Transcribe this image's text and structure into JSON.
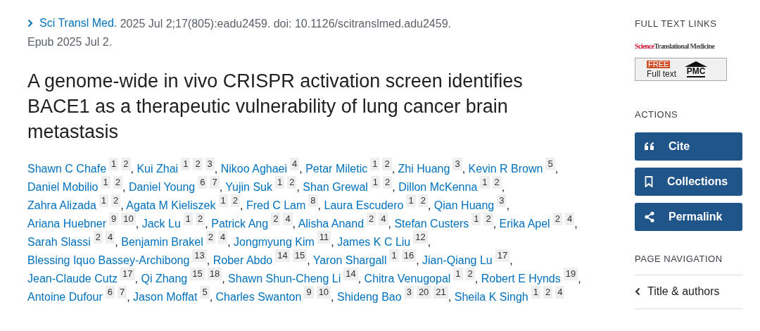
{
  "citation": {
    "journal": "Sci Transl Med.",
    "details": "2025 Jul 2;17(805):eadu2459. doi: 10.1126/scitranslmed.adu2459.",
    "epub": "Epub 2025 Jul 2."
  },
  "title": "A genome-wide in vivo CRISPR activation screen identifies BACE1 as a therapeutic vulnerability of lung cancer brain metastasis",
  "authors": [
    {
      "name": "Shawn C Chafe",
      "affiliations": [
        "1",
        "2"
      ],
      "trailing": ","
    },
    {
      "name": "Kui Zhai",
      "affiliations": [
        "1",
        "2",
        "3"
      ],
      "trailing": ","
    },
    {
      "name": "Nikoo Aghaei",
      "affiliations": [
        "4"
      ],
      "trailing": ","
    },
    {
      "name": "Petar Miletic",
      "affiliations": [
        "1",
        "2"
      ],
      "trailing": ","
    },
    {
      "name": "Zhi Huang",
      "affiliations": [
        "3"
      ],
      "trailing": ","
    },
    {
      "name": "Kevin R Brown",
      "affiliations": [
        "5"
      ],
      "trailing": ","
    },
    {
      "name": "Daniel Mobilio",
      "affiliations": [
        "1",
        "2"
      ],
      "trailing": ","
    },
    {
      "name": "Daniel Young",
      "affiliations": [
        "6",
        "7"
      ],
      "trailing": ","
    },
    {
      "name": "Yujin Suk",
      "affiliations": [
        "1",
        "2"
      ],
      "trailing": ","
    },
    {
      "name": "Shan Grewal",
      "affiliations": [
        "1",
        "2"
      ],
      "trailing": ","
    },
    {
      "name": "Dillon McKenna",
      "affiliations": [
        "1",
        "2"
      ],
      "trailing": ","
    },
    {
      "name": "Zahra Alizada",
      "affiliations": [
        "1",
        "2"
      ],
      "trailing": ","
    },
    {
      "name": "Agata M Kieliszek",
      "affiliations": [
        "1",
        "2"
      ],
      "trailing": ","
    },
    {
      "name": "Fred C Lam",
      "affiliations": [
        "8"
      ],
      "trailing": ","
    },
    {
      "name": "Laura Escudero",
      "affiliations": [
        "1",
        "2"
      ],
      "trailing": ","
    },
    {
      "name": "Qian Huang",
      "affiliations": [
        "3"
      ],
      "trailing": ","
    },
    {
      "name": "Ariana Huebner",
      "affiliations": [
        "9",
        "10"
      ],
      "trailing": ","
    },
    {
      "name": "Jack Lu",
      "affiliations": [
        "1",
        "2"
      ],
      "trailing": ","
    },
    {
      "name": "Patrick Ang",
      "affiliations": [
        "2",
        "4"
      ],
      "trailing": ","
    },
    {
      "name": "Alisha Anand",
      "affiliations": [
        "2",
        "4"
      ],
      "trailing": ","
    },
    {
      "name": "Stefan Custers",
      "affiliations": [
        "1",
        "2"
      ],
      "trailing": ","
    },
    {
      "name": "Erika Apel",
      "affiliations": [
        "2",
        "4"
      ],
      "trailing": ","
    },
    {
      "name": "Sarah Slassi",
      "affiliations": [
        "2",
        "4"
      ],
      "trailing": ","
    },
    {
      "name": "Benjamin Brakel",
      "affiliations": [
        "2",
        "4"
      ],
      "trailing": ","
    },
    {
      "name": "Jongmyung Kim",
      "affiliations": [
        "11"
      ],
      "trailing": ","
    },
    {
      "name": "James K C Liu",
      "affiliations": [
        "12"
      ],
      "trailing": ","
    },
    {
      "name": "Blessing Iquo Bassey-Archibong",
      "affiliations": [
        "13"
      ],
      "trailing": ","
    },
    {
      "name": "Rober Abdo",
      "affiliations": [
        "14",
        "15"
      ],
      "trailing": ","
    },
    {
      "name": "Yaron Shargall",
      "affiliations": [
        "1",
        "16"
      ],
      "trailing": ","
    },
    {
      "name": "Jian-Qiang Lu",
      "affiliations": [
        "17"
      ],
      "trailing": ","
    },
    {
      "name": "Jean-Claude Cutz",
      "affiliations": [
        "17"
      ],
      "trailing": ","
    },
    {
      "name": "Qi Zhang",
      "affiliations": [
        "15",
        "18"
      ],
      "trailing": ","
    },
    {
      "name": "Shawn Shun-Cheng Li",
      "affiliations": [
        "14"
      ],
      "trailing": ","
    },
    {
      "name": "Chitra Venugopal",
      "affiliations": [
        "1",
        "2"
      ],
      "trailing": ","
    },
    {
      "name": "Robert E Hynds",
      "affiliations": [
        "19"
      ],
      "trailing": ","
    },
    {
      "name": "Antoine Dufour",
      "affiliations": [
        "6",
        "7"
      ],
      "trailing": ","
    },
    {
      "name": "Jason Moffat",
      "affiliations": [
        "5"
      ],
      "trailing": ","
    },
    {
      "name": "Charles Swanton",
      "affiliations": [
        "9",
        "10"
      ],
      "trailing": ","
    },
    {
      "name": "Shideng Bao",
      "affiliations": [
        "3",
        "20",
        "21"
      ],
      "trailing": ","
    },
    {
      "name": "Sheila K Singh",
      "affiliations": [
        "1",
        "2",
        "4"
      ]
    }
  ],
  "sidebar": {
    "full_text_links": {
      "heading": "FULL TEXT LINKS",
      "publisher_logo": {
        "part_1": "Science",
        "part_2": "Translational Medicine"
      },
      "pmc_badge": {
        "tag": "FREE",
        "label": "Full text",
        "brand": "PMC"
      }
    },
    "actions": {
      "heading": "ACTIONS",
      "buttons": [
        {
          "kind": "cite",
          "label": "Cite"
        },
        {
          "kind": "collections",
          "label": "Collections"
        },
        {
          "kind": "permalink",
          "label": "Permalink"
        }
      ]
    },
    "page_navigation": {
      "heading": "PAGE NAVIGATION",
      "items": [
        {
          "label": "Title & authors"
        }
      ]
    }
  }
}
